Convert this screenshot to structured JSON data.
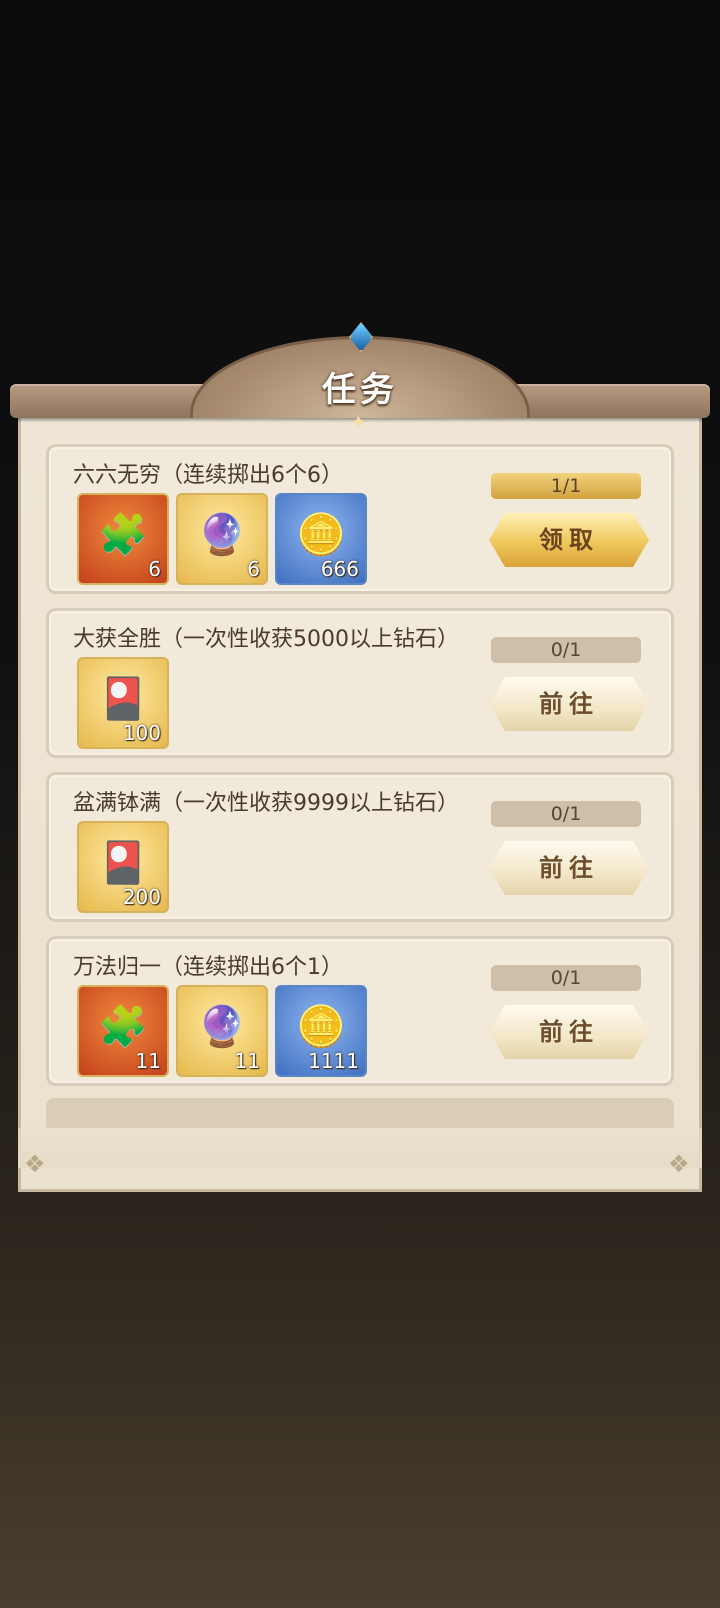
{
  "dialog": {
    "title": "任务"
  },
  "tasks": [
    {
      "title": "六六无穷（连续掷出6个6）",
      "progress": "1/1",
      "button": "领取",
      "rewards": [
        {
          "icon": "dice-puzzle-icon",
          "count": "6",
          "color": "red"
        },
        {
          "icon": "crystal-icon",
          "count": "6",
          "color": "gold"
        },
        {
          "icon": "silver-coin-icon",
          "count": "666",
          "color": "blue"
        }
      ]
    },
    {
      "title": "大获全胜（一次性收获5000以上钻石）",
      "progress": "0/1",
      "button": "前往",
      "rewards": [
        {
          "icon": "purple-card-icon",
          "count": "100",
          "color": "gold"
        }
      ]
    },
    {
      "title": "盆满钵满（一次性收获9999以上钻石）",
      "progress": "0/1",
      "button": "前往",
      "rewards": [
        {
          "icon": "purple-card-icon",
          "count": "200",
          "color": "gold"
        }
      ]
    },
    {
      "title": "万法归一（连续掷出6个1）",
      "progress": "0/1",
      "button": "前往",
      "rewards": [
        {
          "icon": "dice-puzzle-icon",
          "count": "11",
          "color": "red"
        },
        {
          "icon": "crystal-icon",
          "count": "11",
          "color": "gold"
        },
        {
          "icon": "silver-coin-icon",
          "count": "1111",
          "color": "blue"
        }
      ]
    }
  ],
  "colors": {
    "accent_gold": "#d9a33a",
    "panel": "#efe6d6",
    "text": "#4a3a2c"
  }
}
